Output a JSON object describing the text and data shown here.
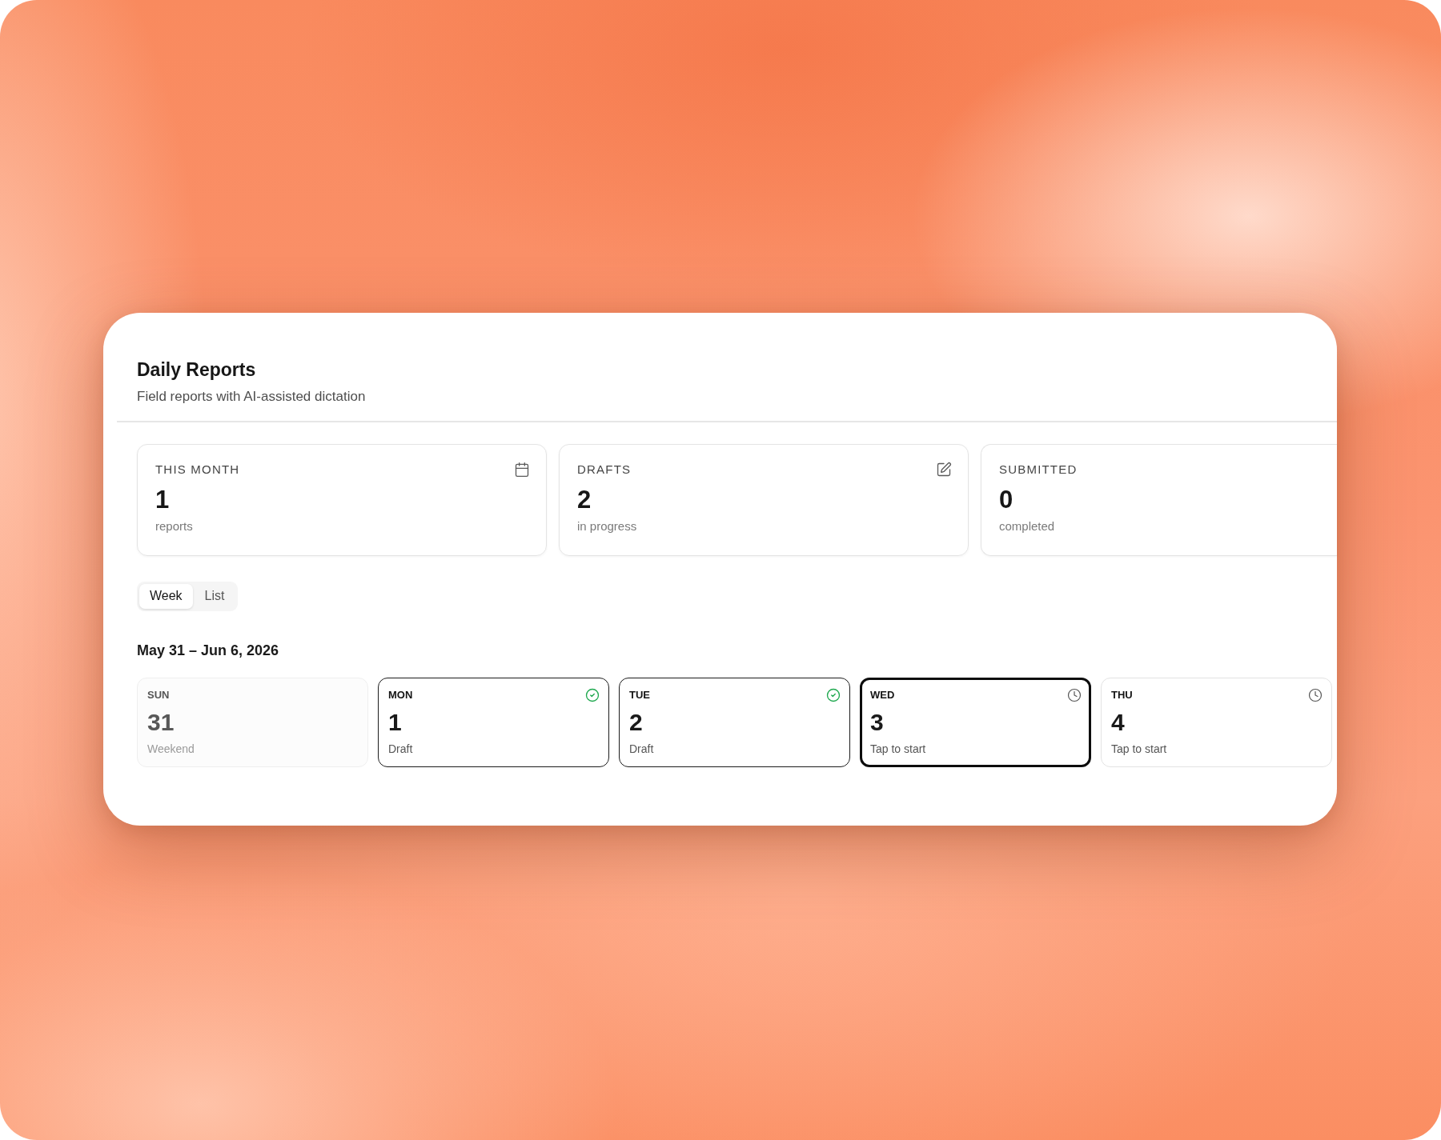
{
  "header": {
    "title": "Daily Reports",
    "subtitle": "Field reports with AI-assisted dictation"
  },
  "stats": [
    {
      "label": "THIS MONTH",
      "value": "1",
      "caption": "reports"
    },
    {
      "label": "DRAFTS",
      "value": "2",
      "caption": "in progress"
    },
    {
      "label": "SUBMITTED",
      "value": "0",
      "caption": "completed"
    }
  ],
  "view_tabs": [
    {
      "label": "Week",
      "selected": true
    },
    {
      "label": "List",
      "selected": false
    }
  ],
  "week": {
    "range": "May 31 – Jun 6, 2026",
    "days": [
      {
        "weekday": "SUN",
        "date": "31",
        "status": "Weekend",
        "kind": "weekend",
        "selected": false
      },
      {
        "weekday": "MON",
        "date": "1",
        "status": "Draft",
        "kind": "draft",
        "selected": false
      },
      {
        "weekday": "TUE",
        "date": "2",
        "status": "Draft",
        "kind": "draft",
        "selected": false
      },
      {
        "weekday": "WED",
        "date": "3",
        "status": "Tap to start",
        "kind": "pending",
        "selected": true
      },
      {
        "weekday": "THU",
        "date": "4",
        "status": "Tap to start",
        "kind": "pending",
        "selected": false
      }
    ]
  }
}
